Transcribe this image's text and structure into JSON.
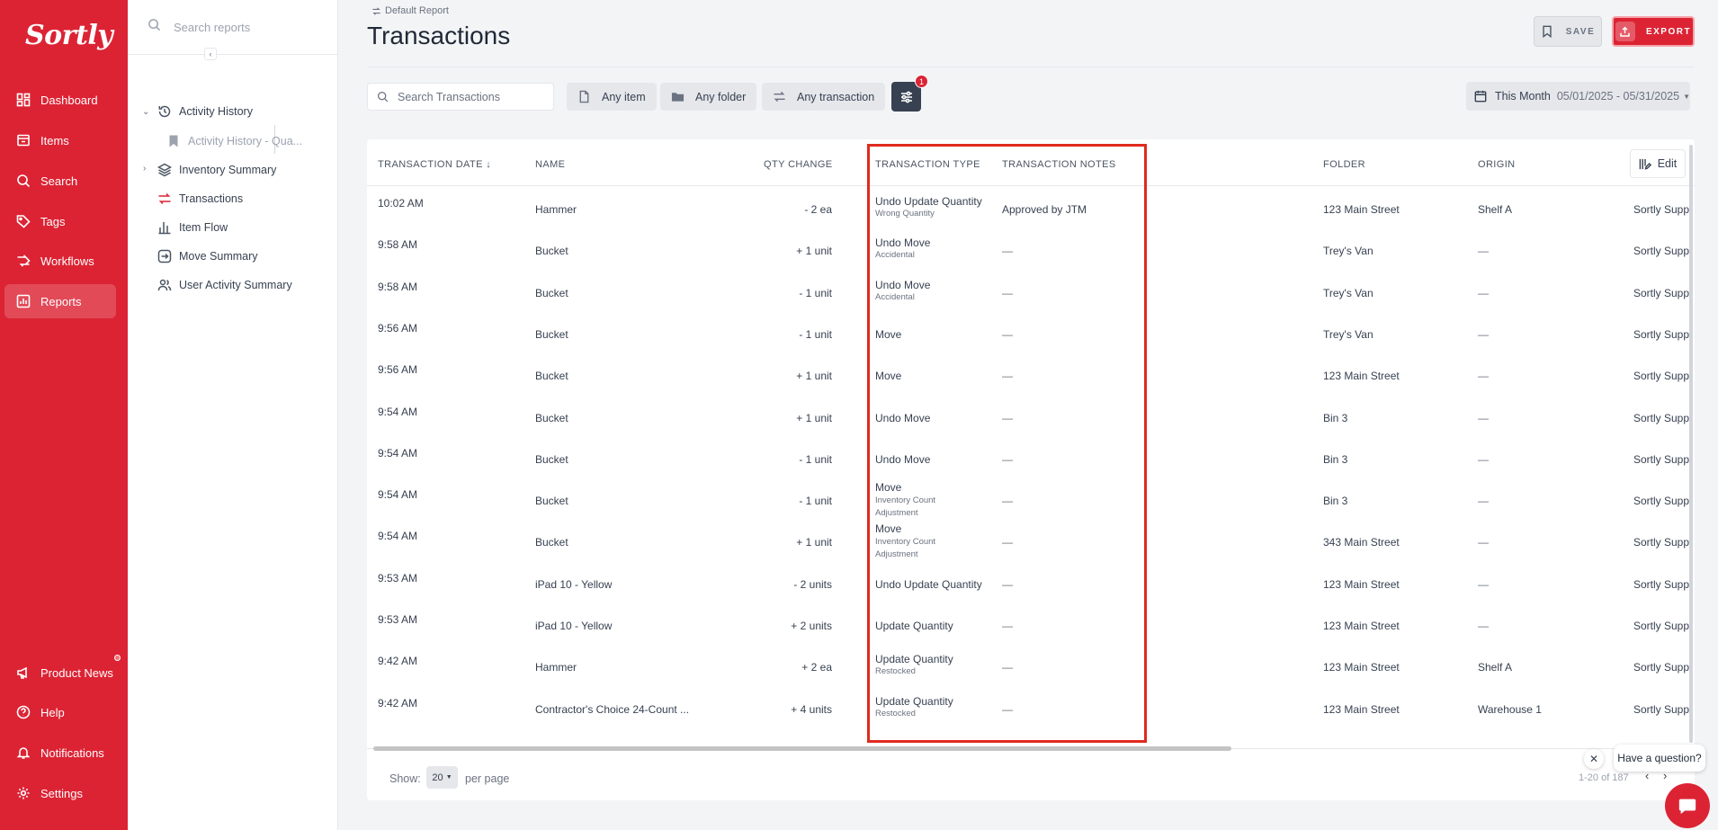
{
  "brand": {
    "logo": "Sortly",
    "accent": "#dc2334",
    "highlight": "#e02a1e"
  },
  "nav": {
    "main": [
      {
        "label": "Dashboard",
        "icon": "dashboard-icon"
      },
      {
        "label": "Items",
        "icon": "items-icon"
      },
      {
        "label": "Search",
        "icon": "search-icon"
      },
      {
        "label": "Tags",
        "icon": "tag-icon"
      },
      {
        "label": "Workflows",
        "icon": "workflow-icon"
      },
      {
        "label": "Reports",
        "icon": "reports-icon",
        "active": true
      }
    ],
    "bottom": [
      {
        "label": "Product News",
        "icon": "megaphone-icon"
      },
      {
        "label": "Help",
        "icon": "help-icon"
      },
      {
        "label": "Notifications",
        "icon": "bell-icon"
      },
      {
        "label": "Settings",
        "icon": "gear-icon"
      }
    ]
  },
  "reports_sidebar": {
    "search_placeholder": "Search reports",
    "items": [
      {
        "label": "Activity History"
      },
      {
        "label": "Activity History - Qua..."
      },
      {
        "label": "Inventory Summary"
      },
      {
        "label": "Transactions"
      },
      {
        "label": "Item Flow"
      },
      {
        "label": "Move Summary"
      },
      {
        "label": "User Activity Summary"
      }
    ]
  },
  "header": {
    "breadcrumb": "Default Report",
    "title": "Transactions",
    "save_label": "SAVE",
    "export_label": "EXPORT"
  },
  "filters": {
    "search_placeholder": "Search Transactions",
    "item": "Any item",
    "folder": "Any folder",
    "transaction": "Any transaction",
    "active_filter_count": "1",
    "date_label": "This Month",
    "date_range": "05/01/2025 - 05/31/2025"
  },
  "table": {
    "columns": {
      "date": "TRANSACTION DATE",
      "name": "NAME",
      "qty": "QTY CHANGE",
      "type": "TRANSACTION TYPE",
      "notes": "TRANSACTION NOTES",
      "folder": "FOLDER",
      "origin": "ORIGIN"
    },
    "edit_label": "Edit",
    "rows": [
      {
        "date": "10:02 AM",
        "name": "Hammer",
        "qty": "- 2  ea",
        "type": "Undo Update Quantity",
        "type_sub": "Wrong Quantity",
        "notes": "Approved by JTM",
        "folder": "123 Main Street",
        "origin": "Shelf A",
        "extra": "Sortly Supp"
      },
      {
        "date": "9:58 AM",
        "name": "Bucket",
        "qty": "+ 1  unit",
        "type": "Undo Move",
        "type_sub": "Accidental",
        "notes": "—",
        "folder": "Trey's Van",
        "origin": "—",
        "extra": "Sortly Supp"
      },
      {
        "date": "9:58 AM",
        "name": "Bucket",
        "qty": "- 1  unit",
        "type": "Undo Move",
        "type_sub": "Accidental",
        "notes": "—",
        "folder": "Trey's Van",
        "origin": "—",
        "extra": "Sortly Supp"
      },
      {
        "date": "9:56 AM",
        "name": "Bucket",
        "qty": "- 1  unit",
        "type": "Move",
        "type_sub": "",
        "notes": "—",
        "folder": "Trey's Van",
        "origin": "—",
        "extra": "Sortly Supp"
      },
      {
        "date": "9:56 AM",
        "name": "Bucket",
        "qty": "+ 1  unit",
        "type": "Move",
        "type_sub": "",
        "notes": "—",
        "folder": "123 Main Street",
        "origin": "—",
        "extra": "Sortly Supp"
      },
      {
        "date": "9:54 AM",
        "name": "Bucket",
        "qty": "+ 1  unit",
        "type": "Undo Move",
        "type_sub": "",
        "notes": "—",
        "folder": "Bin 3",
        "origin": "—",
        "extra": "Sortly Supp"
      },
      {
        "date": "9:54 AM",
        "name": "Bucket",
        "qty": "- 1  unit",
        "type": "Undo Move",
        "type_sub": "",
        "notes": "—",
        "folder": "Bin 3",
        "origin": "—",
        "extra": "Sortly Supp"
      },
      {
        "date": "9:54 AM",
        "name": "Bucket",
        "qty": "- 1  unit",
        "type": "Move",
        "type_sub": "Inventory Count Adjustment",
        "notes": "—",
        "folder": "Bin 3",
        "origin": "—",
        "extra": "Sortly Supp"
      },
      {
        "date": "9:54 AM",
        "name": "Bucket",
        "qty": "+ 1  unit",
        "type": "Move",
        "type_sub": "Inventory Count Adjustment",
        "notes": "—",
        "folder": "343 Main Street",
        "origin": "—",
        "extra": "Sortly Supp"
      },
      {
        "date": "9:53 AM",
        "name": "iPad 10 - Yellow",
        "qty": "- 2  units",
        "type": "Undo Update Quantity",
        "type_sub": "",
        "notes": "—",
        "folder": "123 Main Street",
        "origin": "—",
        "extra": "Sortly Supp"
      },
      {
        "date": "9:53 AM",
        "name": "iPad 10 - Yellow",
        "qty": "+ 2  units",
        "type": "Update Quantity",
        "type_sub": "",
        "notes": "—",
        "folder": "123 Main Street",
        "origin": "—",
        "extra": "Sortly Supp"
      },
      {
        "date": "9:42 AM",
        "name": "Hammer",
        "qty": "+ 2  ea",
        "type": "Update Quantity",
        "type_sub": "Restocked",
        "notes": "—",
        "folder": "123 Main Street",
        "origin": "Shelf A",
        "extra": "Sortly Supp"
      },
      {
        "date": "9:42 AM",
        "name": "Contractor's Choice 24-Count ...",
        "qty": "+ 4  units",
        "type": "Update Quantity",
        "type_sub": "Restocked",
        "notes": "—",
        "folder": "123 Main Street",
        "origin": "Warehouse 1",
        "extra": "Sortly Supp"
      }
    ]
  },
  "footer": {
    "show_label": "Show:",
    "per_page_value": "20",
    "per_page_label": "per page",
    "range": "1-20 of 187"
  },
  "chat": {
    "prompt": "Have a question?"
  }
}
